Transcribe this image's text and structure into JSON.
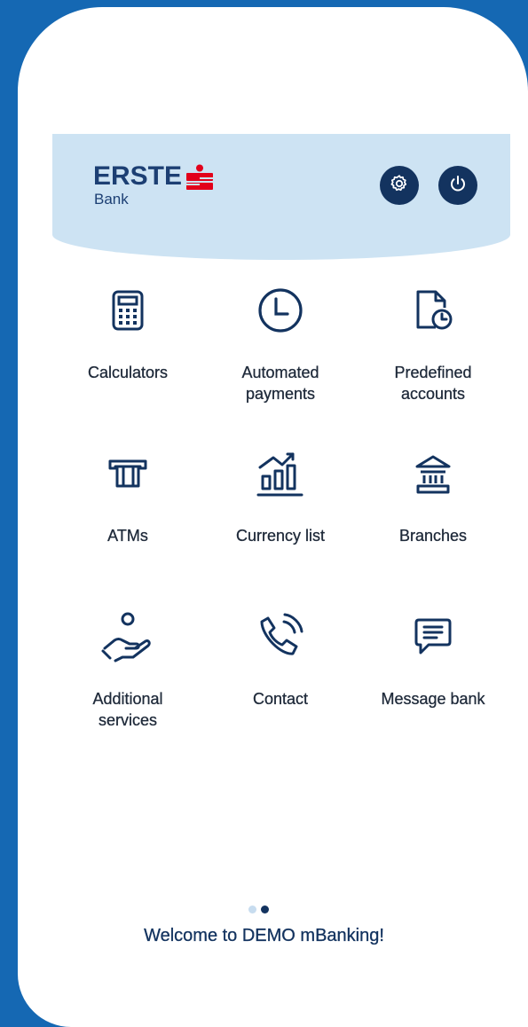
{
  "header": {
    "brand": "ERSTE",
    "brand_sub": "Bank",
    "settings_icon": "gear-icon",
    "power_icon": "power-icon",
    "accent_color": "#e2001a",
    "navy_color": "#13335f"
  },
  "menu": {
    "items": [
      {
        "label_lines": [
          "Calculators"
        ],
        "icon": "calculator-icon"
      },
      {
        "label_lines": [
          "Automated",
          "payments"
        ],
        "icon": "clock-icon"
      },
      {
        "label_lines": [
          "Predefined",
          "accounts"
        ],
        "icon": "document-clock-icon"
      },
      {
        "label_lines": [
          "ATMs"
        ],
        "icon": "atm-icon"
      },
      {
        "label_lines": [
          "Currency list"
        ],
        "icon": "bar-chart-icon"
      },
      {
        "label_lines": [
          "Branches"
        ],
        "icon": "bank-building-icon"
      },
      {
        "label_lines": [
          "Additional",
          "services"
        ],
        "icon": "hand-person-icon"
      },
      {
        "label_lines": [
          "Contact"
        ],
        "icon": "phone-call-icon"
      },
      {
        "label_lines": [
          "Message bank"
        ],
        "icon": "message-icon"
      }
    ]
  },
  "pager": {
    "pages": 2,
    "active_index": 1
  },
  "footer": {
    "welcome": "Welcome to DEMO mBanking!"
  }
}
